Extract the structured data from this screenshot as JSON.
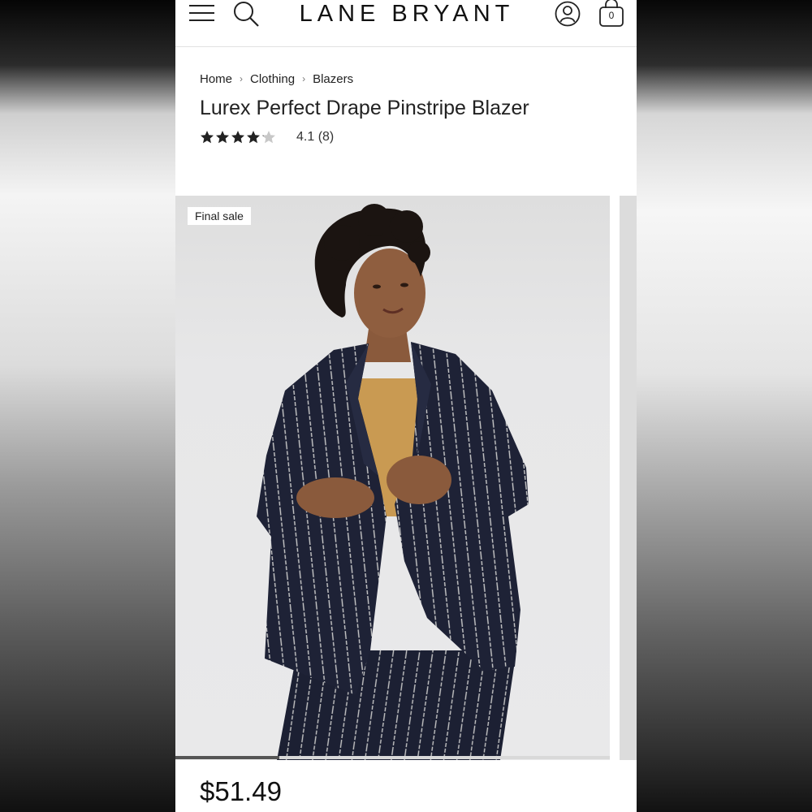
{
  "brand": {
    "logo_text": "LANE BRYANT"
  },
  "header": {
    "icons": [
      "menu-icon",
      "search-icon",
      "account-icon",
      "shopping-bag-icon"
    ],
    "bag_count": "0"
  },
  "breadcrumb": {
    "items": [
      "Home",
      "Clothing",
      "Blazers"
    ],
    "separator": "›"
  },
  "product": {
    "title": "Lurex Perfect Drape Pinstripe Blazer",
    "rating_value": 4.1,
    "rating_text": "4.1 (8)",
    "rating_max": 5,
    "badge": "Final sale",
    "price": "$51.49",
    "gallery_progress": 0.24
  },
  "colors": {
    "text": "#222222",
    "blazer_navy": "#1e2236",
    "top_mustard": "#c99a52",
    "image_bg": "#e8e8e9"
  }
}
